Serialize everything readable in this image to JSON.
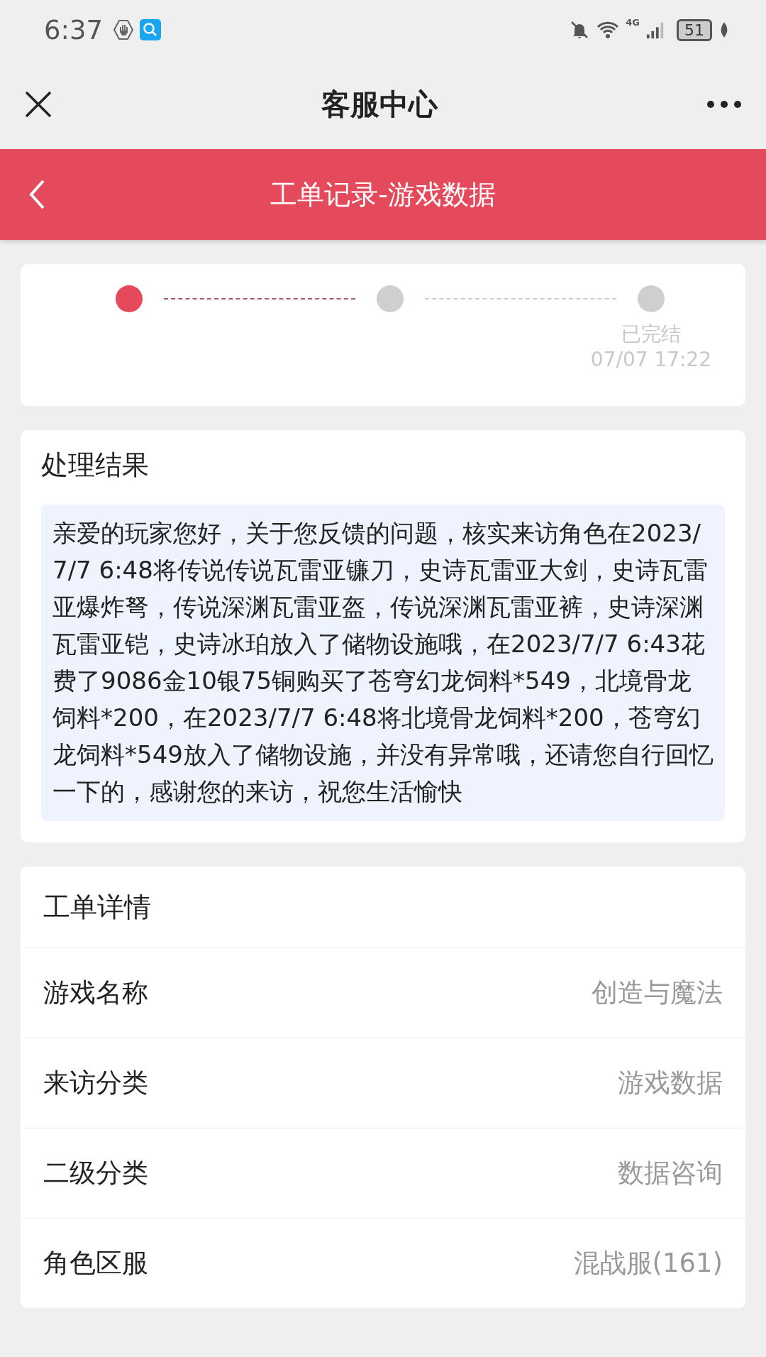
{
  "status_bar": {
    "time": "6:37",
    "network": "4G",
    "battery": "51"
  },
  "app_bar": {
    "title": "客服中心"
  },
  "header": {
    "title": "工单记录-游戏数据"
  },
  "steps": [
    {
      "active": true
    },
    {
      "active": false
    },
    {
      "active": false,
      "label": "已完结",
      "time": "07/07 17:22"
    }
  ],
  "result": {
    "title": "处理结果",
    "text": "亲爱的玩家您好，关于您反馈的问题，核实来访角色在2023/7/7 6:48将传说传说瓦雷亚镰刀，史诗瓦雷亚大剑，史诗瓦雷亚爆炸弩，传说深渊瓦雷亚盔，传说深渊瓦雷亚裤，史诗深渊瓦雷亚铠，史诗冰珀放入了储物设施哦，在2023/7/7 6:43花费了9086金10银75铜购买了苍穹幻龙饲料*549，北境骨龙饲料*200，在2023/7/7 6:48将北境骨龙饲料*200，苍穹幻龙饲料*549放入了储物设施，并没有异常哦，还请您自行回忆一下的，感谢您的来访，祝您生活愉快"
  },
  "details": {
    "title": "工单详情",
    "rows": [
      {
        "label": "游戏名称",
        "value": "创造与魔法"
      },
      {
        "label": "来访分类",
        "value": "游戏数据"
      },
      {
        "label": "二级分类",
        "value": "数据咨询"
      },
      {
        "label": "角色区服",
        "value": "混战服(161)"
      }
    ]
  }
}
